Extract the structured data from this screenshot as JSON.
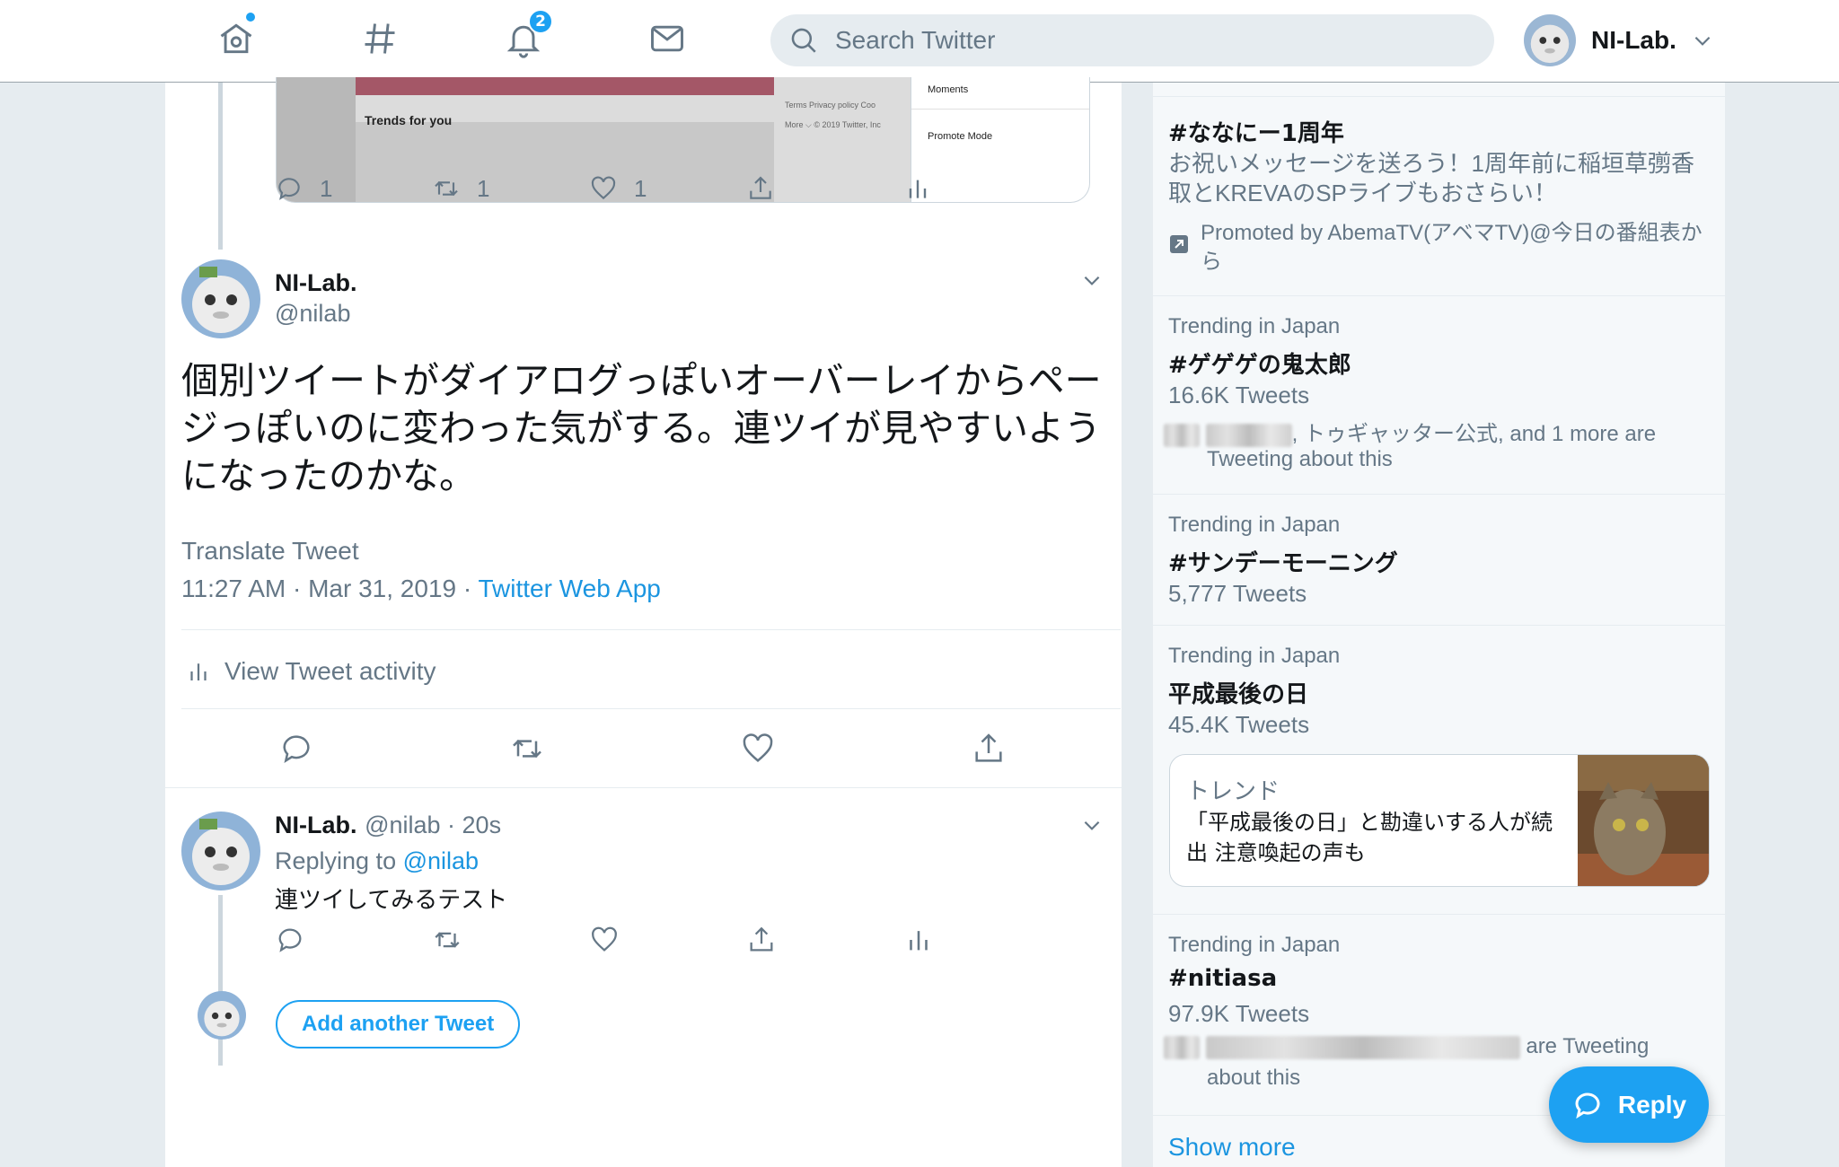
{
  "topbar": {
    "notification_count": "2",
    "search_placeholder": "Search Twitter",
    "account_name": "NI-Lab."
  },
  "prev_tweet": {
    "embedded_screenshot": {
      "trends_label": "Trends for you",
      "footer_line1": "Terms   Privacy policy   Coo",
      "footer_line2": "More ⌵   © 2019 Twitter, Inc",
      "menu_item1": "Moments",
      "menu_item2": "Promote Mode"
    },
    "reply_count": "1",
    "retweet_count": "1",
    "like_count": "1"
  },
  "main_tweet": {
    "name": "NI-Lab.",
    "handle": "@nilab",
    "text": "個別ツイートがダイアログっぽいオーバーレイからページっぽいのに変わった気がする。連ツイが見やすいようになったのかな。",
    "translate": "Translate Tweet",
    "timestamp": "11:27 AM · Mar 31, 2019 · ",
    "source": "Twitter Web App",
    "activity": "View Tweet activity"
  },
  "reply_tweet": {
    "name": "NI-Lab.",
    "handle_time": "@nilab · 20s",
    "replying_to_label": "Replying to ",
    "replying_to_handle": "@nilab",
    "text": "連ツイしてみるテスト"
  },
  "add_tweet_label": "Add another Tweet",
  "sidebar": {
    "promoted": {
      "tag": "#ななにー1周年",
      "desc": "お祝いメッセージを送ろう！1周年前に稲垣草彅香取とKREVAのSPライブもおさらい！",
      "promoted_by": "Promoted by AbemaTV(アベマTV)@今日の番組表から"
    },
    "trends": [
      {
        "context": "Trending in Japan",
        "tag": "#ゲゲゲの鬼太郎",
        "count": "16.6K Tweets",
        "about_suffix": ", トゥギャッター公式, and 1 more are",
        "about_line2": "Tweeting about this"
      },
      {
        "context": "Trending in Japan",
        "tag": "#サンデーモーニング",
        "count": "5,777 Tweets"
      },
      {
        "context": "Trending in Japan",
        "tag": "平成最後の日",
        "count": "45.4K Tweets"
      },
      {
        "context": "Trending in Japan",
        "tag": "#nitiasa",
        "count": "97.9K Tweets",
        "about_suffix": "are Tweeting",
        "about_line2": "about this"
      }
    ],
    "news_card": {
      "label": "トレンド",
      "headline": "「平成最後の日」と勘違いする人が続出 注意喚起の声も"
    },
    "show_more": "Show more"
  },
  "reply_button_label": "Reply"
}
